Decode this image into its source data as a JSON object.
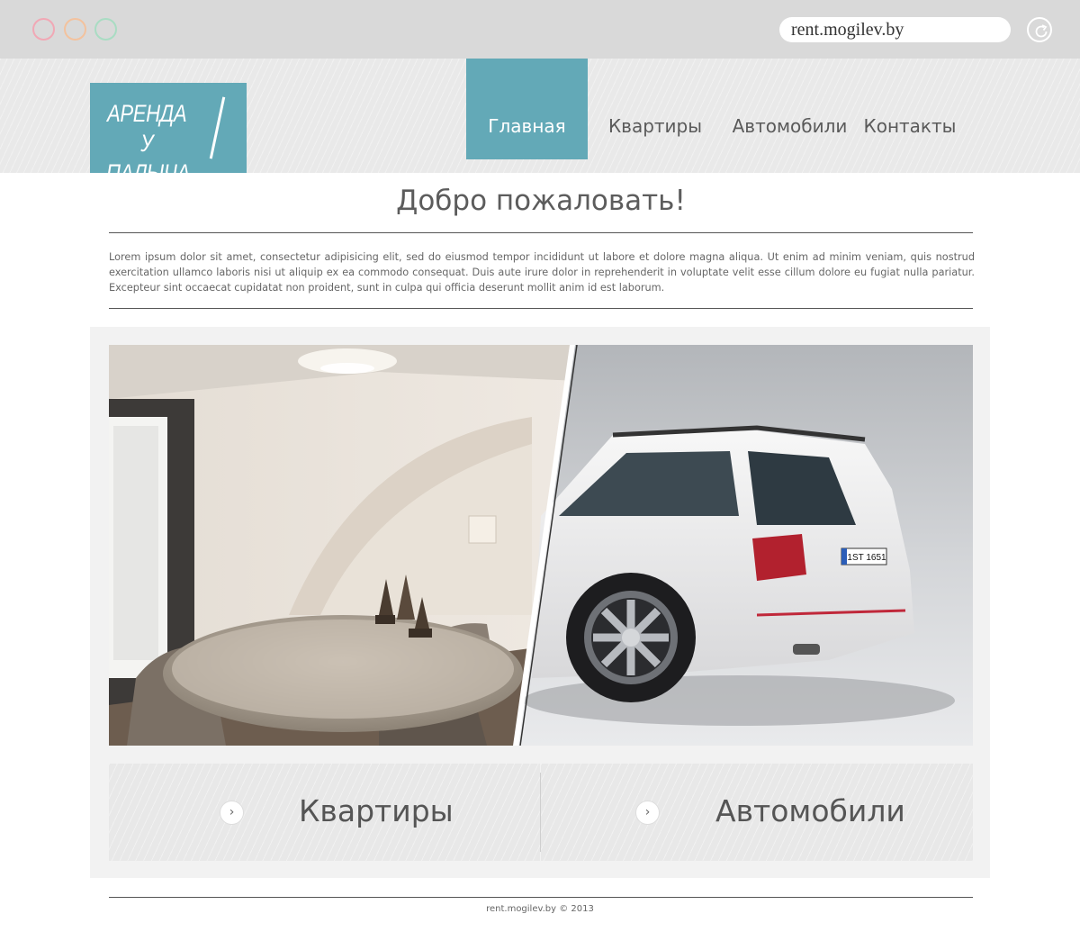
{
  "browser": {
    "url": "rent.mogilev.by",
    "window_buttons": [
      "close",
      "minimize",
      "maximize"
    ],
    "reload_icon": "reload-icon"
  },
  "header": {
    "logo_line1": "АРЕНДА",
    "logo_line2": "У ПАЛЫЧА",
    "nav": [
      {
        "label": "Главная",
        "active": true
      },
      {
        "label": "Квартиры",
        "active": false
      },
      {
        "label": "Автомобили",
        "active": false
      },
      {
        "label": "Контакты",
        "active": false
      }
    ]
  },
  "welcome": {
    "title": "Добро пожаловать!",
    "text": "Lorem ipsum dolor sit amet, consectetur adipisicing elit, sed do eiusmod tempor incididunt ut labore et dolore magna aliqua. Ut enim ad minim veniam, quis nostrud exercitation ullamco laboris nisi ut aliquip ex ea commodo consequat. Duis aute irure dolor in reprehenderit in voluptate velit esse cillum dolore eu fugiat nulla pariatur. Excepteur sint occaecat cupidatat non proident, sunt in culpa qui officia deserunt mollit anim id est laborum."
  },
  "hero": {
    "left_image": "apartment-interior",
    "right_image": "white-station-wagon-car",
    "plate_text": "1ST 1651"
  },
  "categories": [
    {
      "label": "Квартиры",
      "icon": "chevron-right-icon"
    },
    {
      "label": "Автомобили",
      "icon": "chevron-right-icon"
    }
  ],
  "footer": {
    "text": "rent.mogilev.by © 2013"
  },
  "colors": {
    "accent": "#63a9b7",
    "chrome": "#d9d9d9",
    "header_bg": "#e9e9e9"
  }
}
